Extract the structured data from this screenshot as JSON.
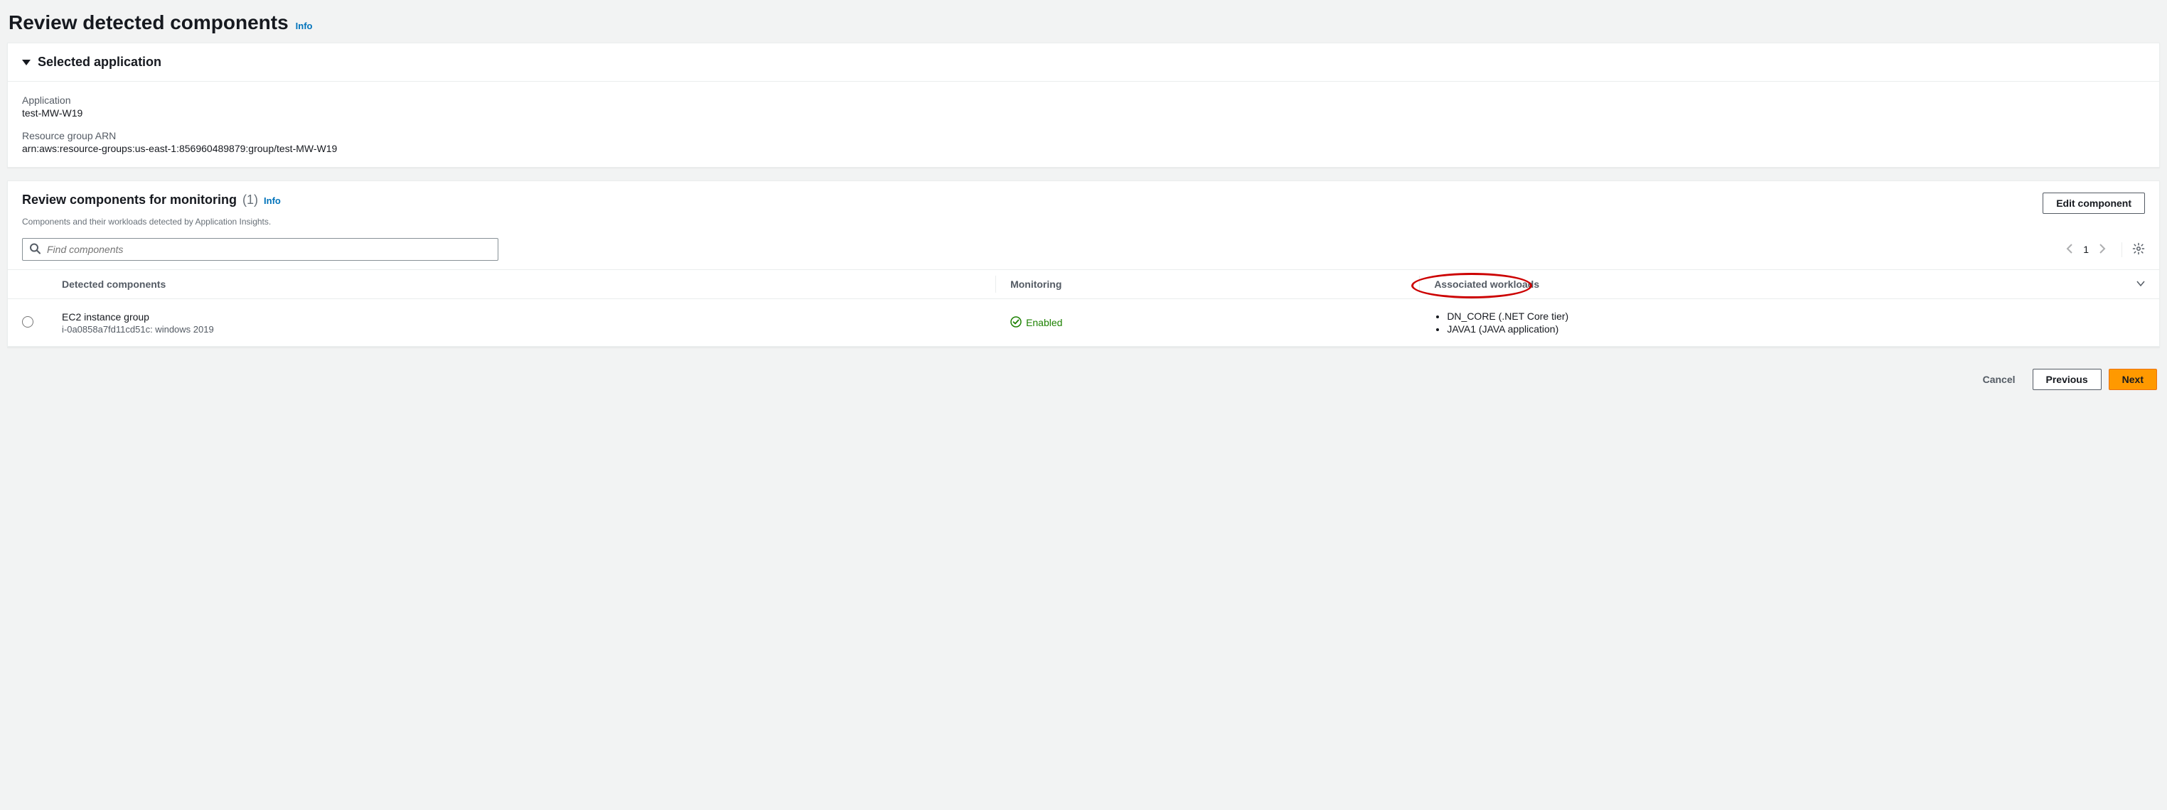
{
  "page": {
    "title": "Review detected components",
    "info": "Info"
  },
  "selected_app": {
    "header": "Selected application",
    "application_label": "Application",
    "application_value": "test-MW-W19",
    "arn_label": "Resource group ARN",
    "arn_value": "arn:aws:resource-groups:us-east-1:856960489879:group/test-MW-W19"
  },
  "review": {
    "title": "Review components for monitoring",
    "count": "(1)",
    "info": "Info",
    "description": "Components and their workloads detected by Application Insights.",
    "edit_button": "Edit component",
    "search_placeholder": "Find components",
    "pager_page": "1"
  },
  "columns": {
    "radio": "",
    "detected": "Detected components",
    "monitoring": "Monitoring",
    "workloads": "Associated workloads"
  },
  "rows": [
    {
      "name": "EC2 instance group",
      "subtitle": "i-0a0858a7fd11cd51c: windows 2019",
      "monitoring": "Enabled",
      "workloads": [
        "DN_CORE (.NET Core tier)",
        "JAVA1 (JAVA application)"
      ]
    }
  ],
  "footer": {
    "cancel": "Cancel",
    "previous": "Previous",
    "next": "Next"
  }
}
